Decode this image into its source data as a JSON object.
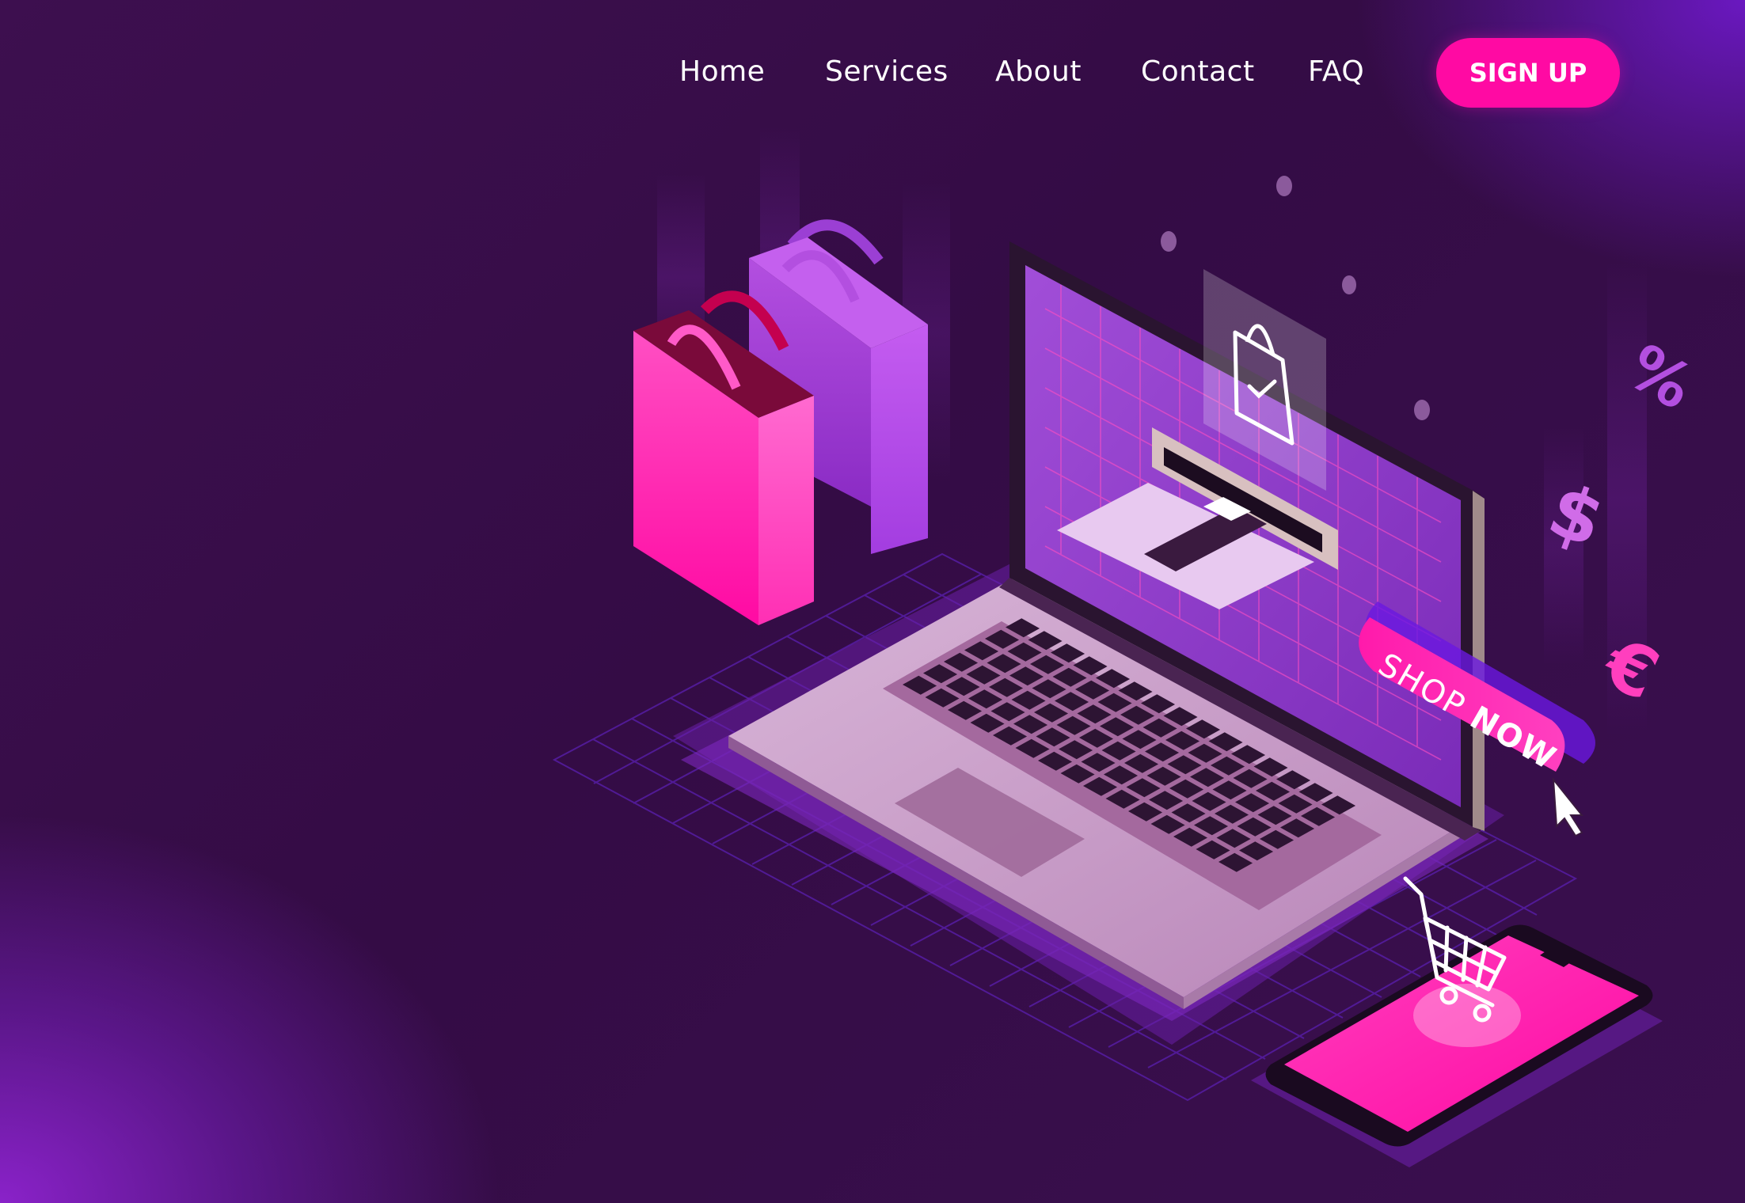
{
  "nav": {
    "links": [
      "Home",
      "Services",
      "About",
      "Contact",
      "FAQ"
    ],
    "signup_label": "SIGN UP"
  },
  "hero": {
    "cta_prefix": "SHOP ",
    "cta_emphasis": "NOW",
    "floating_symbols": [
      "%",
      "$",
      "€"
    ]
  },
  "icons": {
    "shopping_bag_screen": "shopping-bag-check-icon",
    "cart": "shopping-cart-icon",
    "pointer": "mouse-pointer-icon",
    "card": "credit-card-icon"
  },
  "colors": {
    "accent_pink": "#ff0aa3",
    "bg_dark": "#340c45",
    "glow_purple": "#8a22c9",
    "bag_purple": "#b040e8"
  }
}
